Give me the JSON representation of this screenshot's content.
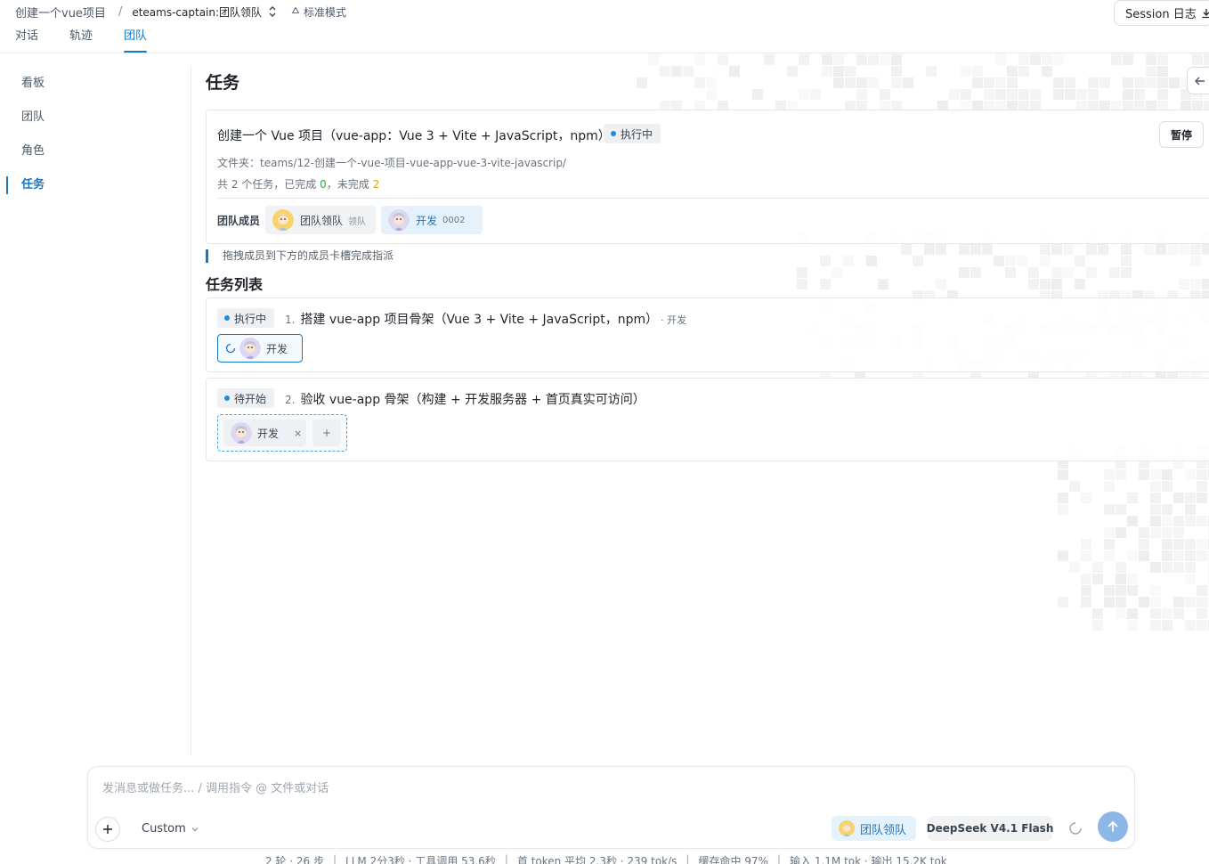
{
  "header": {
    "project": "创建一个vue项目",
    "separator": "/",
    "team": "eteams-captain:团队领队",
    "mode": "标准模式",
    "session_log": "Session 日志"
  },
  "tabs": [
    {
      "label": "对话",
      "active": false
    },
    {
      "label": "轨迹",
      "active": false
    },
    {
      "label": "团队",
      "active": true
    }
  ],
  "sidebar": {
    "items": [
      {
        "label": "看板",
        "active": false
      },
      {
        "label": "团队",
        "active": false
      },
      {
        "label": "角色",
        "active": false
      },
      {
        "label": "任务",
        "active": true
      }
    ]
  },
  "page": {
    "title": "任务"
  },
  "task": {
    "title": "创建一个 Vue 项目（vue-app：Vue 3 + Vite + JavaScript，npm）",
    "status": "执行中",
    "pause_label": "暂停",
    "folder_label": "文件夹：",
    "folder_path": "teams/12-创建一个-vue-项目-vue-app-vue-3-vite-javascrip/",
    "stats_prefix": "共 2 个任务，已完成 ",
    "done_count": "0",
    "stats_middle": "，未完成 ",
    "todo_count": "2",
    "members_label": "团队成员",
    "members": [
      {
        "name": "团队领队",
        "tag": "领队"
      },
      {
        "name": "开发",
        "tag": "0002"
      }
    ]
  },
  "hint": "拖拽成员到下方的成员卡槽完成指派",
  "task_list": {
    "title": "任务列表",
    "items": [
      {
        "status": "执行中",
        "index": "1.",
        "title": "搭建 vue-app 项目骨架（Vue 3 + Vite + JavaScript，npm）",
        "assignee_note": "· 开发",
        "slot_member": "开发"
      },
      {
        "status": "待开始",
        "index": "2.",
        "title": "验收 vue-app 骨架（构建 + 开发服务器 + 首页真实可访问）",
        "slot_member": "开发",
        "remove": "×",
        "add": "+"
      }
    ]
  },
  "composer": {
    "placeholder": "发消息或做任务... / 调用指令 @ 文件或对话",
    "mode": "Custom",
    "agent": "团队领队",
    "model": "DeepSeek V4.1 Flash"
  },
  "stats": [
    "2 轮 · 26 步",
    "LLM 2分3秒 · 工具调用 53.6秒",
    "首 token 平均 2.3秒 · 239 tok/s",
    "缓存命中 97%",
    "输入 1.1M tok · 输出 15.2K tok"
  ],
  "colors": {
    "accent": "#1677c7",
    "running_dot": "#1f8ce0",
    "pending_dot": "#1f8ce0",
    "done": "#2fa84f",
    "todo": "#e0a30b"
  }
}
